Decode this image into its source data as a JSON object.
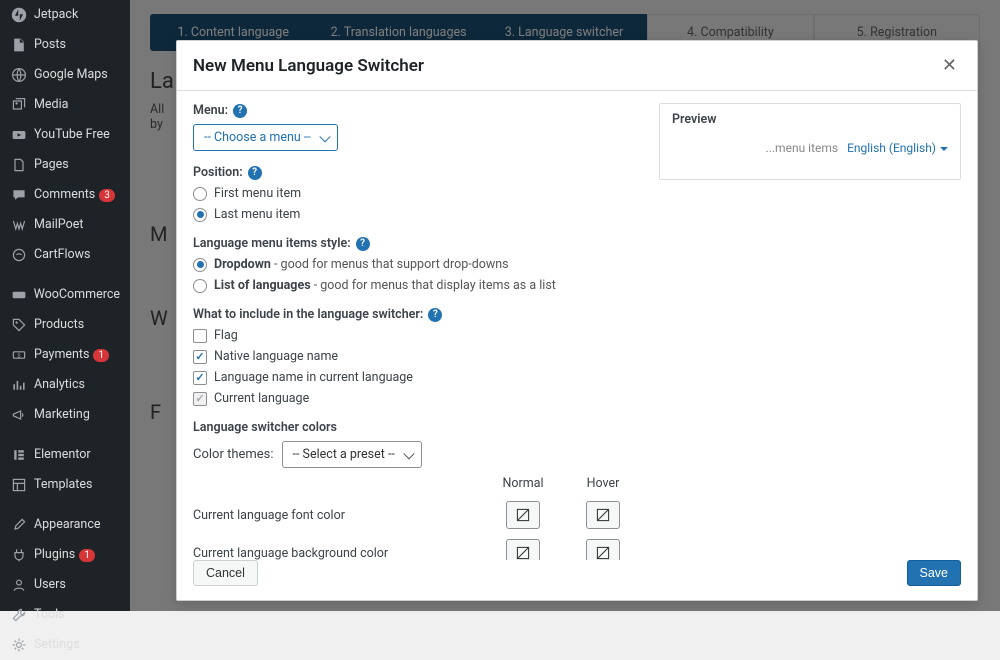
{
  "sidebar": {
    "items": [
      {
        "label": "Jetpack",
        "icon": "jetpack"
      },
      {
        "label": "Posts",
        "icon": "pin"
      },
      {
        "label": "Google Maps",
        "icon": "globe"
      },
      {
        "label": "Media",
        "icon": "media"
      },
      {
        "label": "YouTube Free",
        "icon": "video"
      },
      {
        "label": "Pages",
        "icon": "pages"
      },
      {
        "label": "Comments",
        "icon": "comment",
        "badge": "3"
      },
      {
        "label": "MailPoet",
        "icon": "mail"
      },
      {
        "label": "CartFlows",
        "icon": "cart"
      },
      {
        "label": "WooCommerce",
        "icon": "woo"
      },
      {
        "label": "Products",
        "icon": "tag"
      },
      {
        "label": "Payments",
        "icon": "money",
        "badge": "1"
      },
      {
        "label": "Analytics",
        "icon": "chart"
      },
      {
        "label": "Marketing",
        "icon": "megaphone"
      },
      {
        "label": "Elementor",
        "icon": "elementor"
      },
      {
        "label": "Templates",
        "icon": "templates"
      },
      {
        "label": "Appearance",
        "icon": "brush"
      },
      {
        "label": "Plugins",
        "icon": "plug",
        "badge": "1"
      },
      {
        "label": "Users",
        "icon": "user"
      },
      {
        "label": "Tools",
        "icon": "wrench"
      },
      {
        "label": "Settings",
        "icon": "gear"
      }
    ]
  },
  "steps": [
    {
      "label": "1. Content language",
      "active": true
    },
    {
      "label": "2. Translation languages",
      "active": true
    },
    {
      "label": "3. Language switcher",
      "active": true
    },
    {
      "label": "4. Compatibility",
      "active": false
    },
    {
      "label": "5. Registration",
      "active": false
    }
  ],
  "bg": {
    "heading": "La",
    "line1": "All",
    "line2": "by"
  },
  "modal": {
    "title": "New Menu Language Switcher",
    "menu_label": "Menu:",
    "menu_select": "-- Choose a menu --",
    "position_label": "Position:",
    "position_options": [
      "First menu item",
      "Last menu item"
    ],
    "style_label": "Language menu items style:",
    "style_options": [
      {
        "bold": "Dropdown",
        "rest": " - good for menus that support drop-downs"
      },
      {
        "bold": "List of languages",
        "rest": " - good for menus that display items as a list"
      }
    ],
    "include_label": "What to include in the language switcher:",
    "include_options": [
      "Flag",
      "Native language name",
      "Language name in current language",
      "Current language"
    ],
    "colors_label": "Language switcher colors",
    "color_themes_label": "Color themes:",
    "color_themes_select": "-- Select a preset --",
    "col_normal": "Normal",
    "col_hover": "Hover",
    "row_font": "Current language font color",
    "row_bg": "Current language background color",
    "cancel": "Cancel",
    "save": "Save"
  },
  "preview": {
    "title": "Preview",
    "placeholder": "...menu items",
    "lang": "English (English)"
  },
  "bg_sections": [
    "M",
    "W",
    "F"
  ]
}
